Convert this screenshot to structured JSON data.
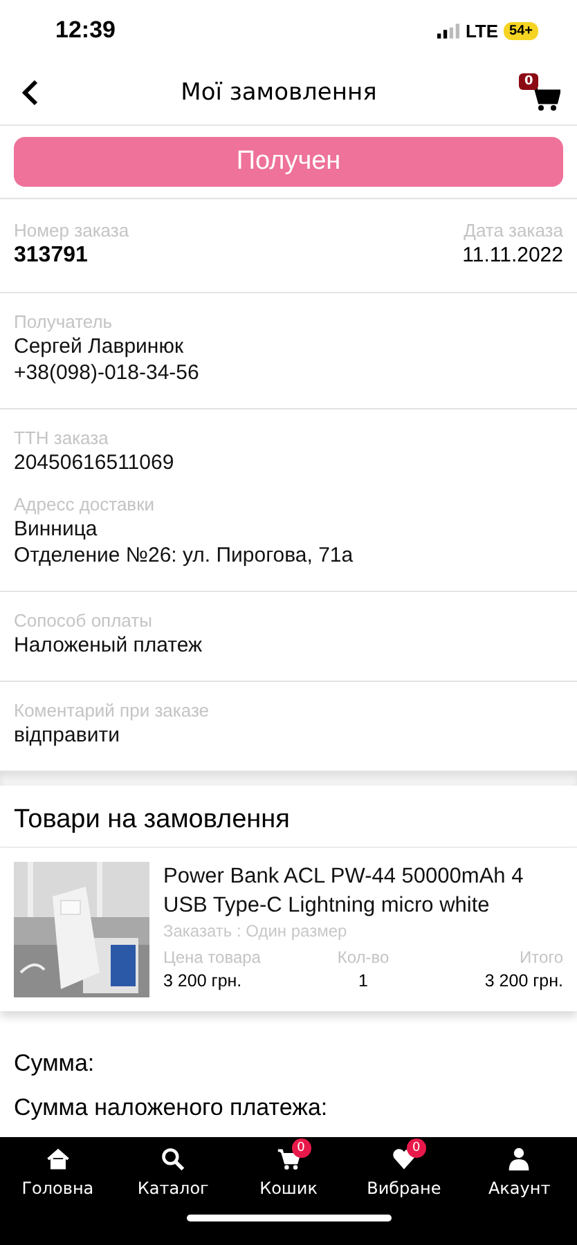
{
  "status_bar": {
    "time": "12:39",
    "network": "LTE",
    "battery": "54+"
  },
  "header": {
    "title": "Мої замовлення",
    "cart_count": "0"
  },
  "order_status": "Получен",
  "order": {
    "number_label": "Номер заказа",
    "number": "313791",
    "date_label": "Дата заказа",
    "date": "11.11.2022"
  },
  "sections": [
    {
      "fields": [
        {
          "label": "Получатель",
          "lines": [
            "Сергей Лавринюк",
            "+38(098)-018-34-56"
          ]
        }
      ]
    },
    {
      "fields": [
        {
          "label": "ТТН заказа",
          "lines": [
            "20450616511069"
          ]
        },
        {
          "label": "Адресс доставки",
          "lines": [
            "Винница",
            "Отделение №26: ул. Пирогова, 71а"
          ]
        }
      ]
    },
    {
      "fields": [
        {
          "label": "Сопособ оплаты",
          "lines": [
            "Наложеный платеж"
          ]
        }
      ]
    },
    {
      "fields": [
        {
          "label": "Коментарий при заказе",
          "lines": [
            "відправити"
          ]
        }
      ]
    }
  ],
  "products_title": "Товари на замовлення",
  "products": [
    {
      "name": "Power Bank ACL PW-44 50000mAh 4 USB Type-C Lightning micro white",
      "option": "Заказать : Один размер",
      "price_label": "Цена товара",
      "price": "3 200 грн.",
      "qty_label": "Кол-во",
      "qty": "1",
      "total_label": "Итого",
      "total": "3 200 грн."
    }
  ],
  "sum_label": "Сумма:",
  "cod_label": "Сумма наложеного платежа:",
  "tab_bar": [
    {
      "kind": "home",
      "label": "Головна"
    },
    {
      "kind": "search",
      "label": "Каталог"
    },
    {
      "kind": "cart",
      "label": "Кошик",
      "badge": "0"
    },
    {
      "kind": "heart",
      "label": "Вибране",
      "badge": "0"
    },
    {
      "kind": "user",
      "label": "Акаунт"
    }
  ]
}
